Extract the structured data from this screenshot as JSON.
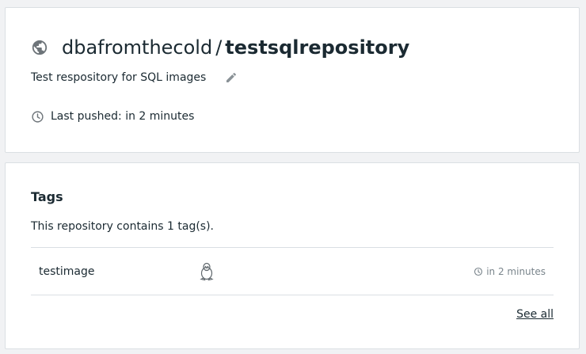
{
  "repo": {
    "namespace": "dbafromthecold",
    "separator": "/",
    "name": "testsqlrepository",
    "description": "Test respository for SQL images",
    "last_pushed": "Last pushed: in 2 minutes",
    "visibility_icon": "globe-icon",
    "edit_icon": "pencil-icon"
  },
  "tags": {
    "heading": "Tags",
    "count_text": "This repository contains 1 tag(s).",
    "rows": [
      {
        "name": "testimage",
        "os_icon": "linux-icon",
        "time": "in 2 minutes"
      }
    ],
    "see_all": "See all"
  },
  "colors": {
    "background": "#f1f2f4",
    "card": "#ffffff",
    "border": "#dadfe3",
    "text": "#1b2a32",
    "muted": "#7a858c"
  }
}
